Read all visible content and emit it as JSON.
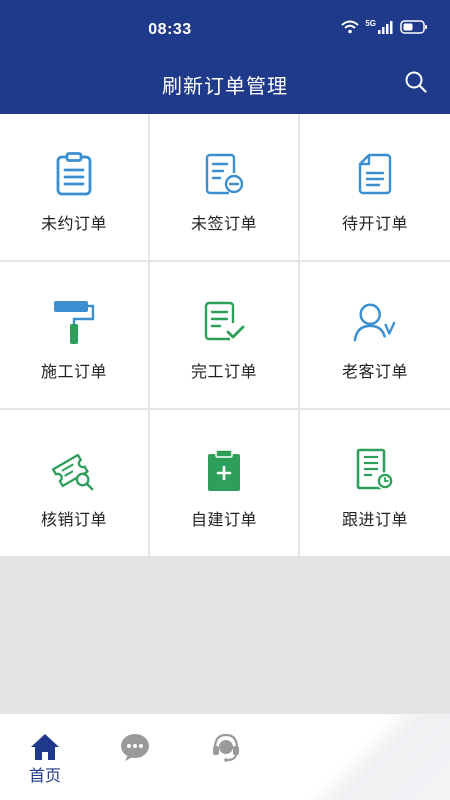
{
  "status_bar": {
    "time": "08:33",
    "network": "5G"
  },
  "header": {
    "title": "刷新订单管理"
  },
  "menu": {
    "items": [
      {
        "label": "未约订单",
        "icon": "clipboard-icon"
      },
      {
        "label": "未签订单",
        "icon": "document-minus-icon"
      },
      {
        "label": "待开订单",
        "icon": "document-icon"
      },
      {
        "label": "施工订单",
        "icon": "paint-roller-icon"
      },
      {
        "label": "完工订单",
        "icon": "document-check-icon"
      },
      {
        "label": "老客订单",
        "icon": "user-check-icon"
      },
      {
        "label": "核销订单",
        "icon": "ticket-search-icon"
      },
      {
        "label": "自建订单",
        "icon": "clipboard-add-icon"
      },
      {
        "label": "跟进订单",
        "icon": "document-clock-icon"
      }
    ]
  },
  "tabbar": {
    "items": [
      {
        "label": "首页",
        "icon": "home-icon",
        "active": true
      },
      {
        "label": "",
        "icon": "chat-icon",
        "active": false
      },
      {
        "label": "",
        "icon": "headset-icon",
        "active": false
      }
    ]
  },
  "colors": {
    "primary": "#1f3a8a",
    "icon_blue": "#3b8fd0",
    "icon_green": "#2e9e5b",
    "inactive": "#9a9a9a"
  }
}
